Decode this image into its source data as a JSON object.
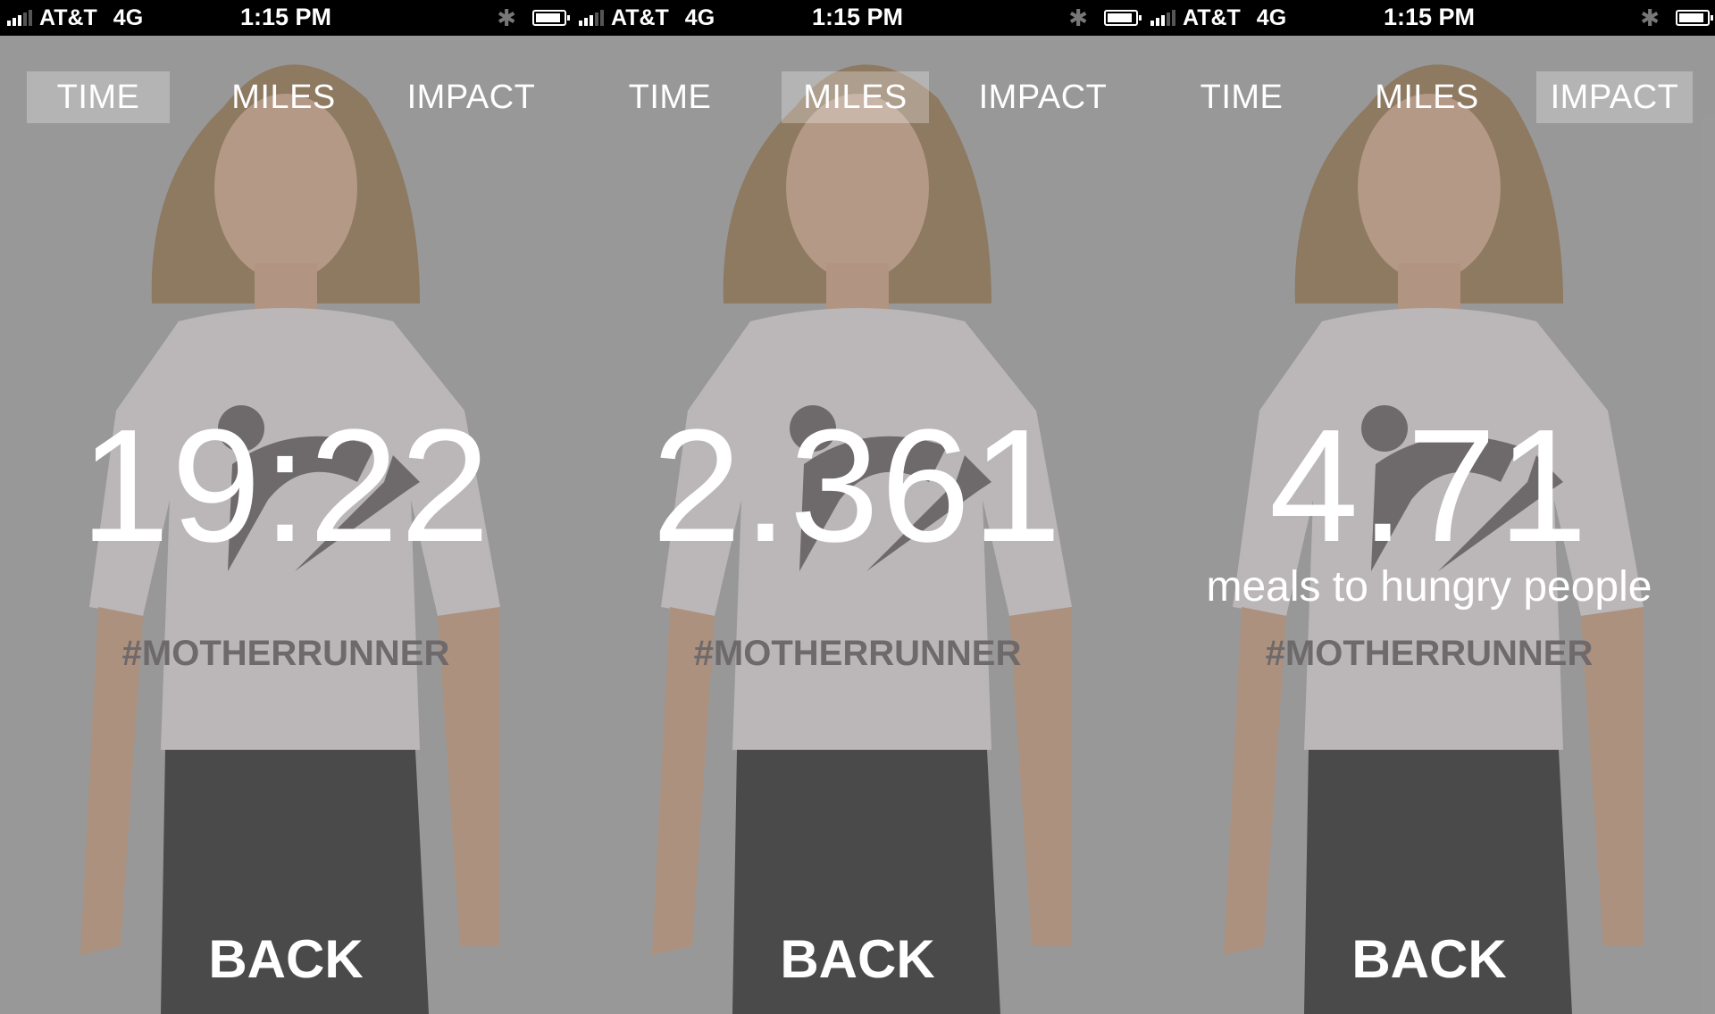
{
  "screens": [
    {
      "status": {
        "carrier": "AT&T",
        "network": "4G",
        "time": "1:15 PM"
      },
      "tabs": [
        {
          "label": "TIME",
          "active": true
        },
        {
          "label": "MILES",
          "active": false
        },
        {
          "label": "IMPACT",
          "active": false
        }
      ],
      "metric": "19:22",
      "subtitle": "",
      "back_label": "BACK",
      "shirt_text": "#MOTHERRUNNER"
    },
    {
      "status": {
        "carrier": "AT&T",
        "network": "4G",
        "time": "1:15 PM"
      },
      "tabs": [
        {
          "label": "TIME",
          "active": false
        },
        {
          "label": "MILES",
          "active": true
        },
        {
          "label": "IMPACT",
          "active": false
        }
      ],
      "metric": "2.361",
      "subtitle": "",
      "back_label": "BACK",
      "shirt_text": "#MOTHERRUNNER"
    },
    {
      "status": {
        "carrier": "AT&T",
        "network": "4G",
        "time": "1:15 PM"
      },
      "tabs": [
        {
          "label": "TIME",
          "active": false
        },
        {
          "label": "MILES",
          "active": false
        },
        {
          "label": "IMPACT",
          "active": true
        }
      ],
      "metric": "4.71",
      "subtitle": "meals to hungry people",
      "back_label": "BACK",
      "shirt_text": "#MOTHERRUNNER"
    }
  ],
  "icons": [
    "signal-icon",
    "bluetooth-icon",
    "battery-icon"
  ],
  "colors": {
    "overlay": "#9c9c9c",
    "text": "#ffffff",
    "statusbar": "#000000"
  }
}
